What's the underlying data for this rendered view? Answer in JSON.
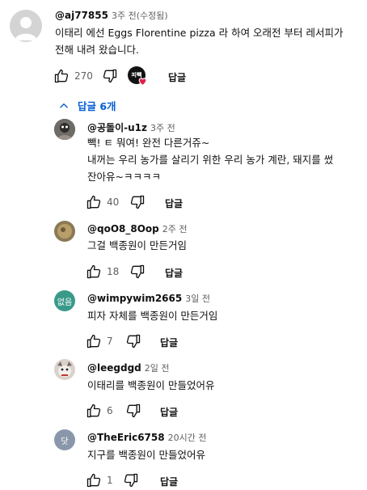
{
  "main_comment": {
    "handle": "@aj77855",
    "time": "3주 전(수정됨)",
    "text_line1": "이태리 에선 Eggs Florentine pizza 라 하여 오래전 부터 레서피가",
    "text_line2": "전해 내려 왔습니다.",
    "likes": "270",
    "reply_label": "답글",
    "creator_badge_text": "피빽"
  },
  "replies_toggle": {
    "label": "답글 6개"
  },
  "replies": [
    {
      "handle": "@공돌이-u1z",
      "time": "3주 전",
      "lines": [
        "빽! ㅌ 뭐여! 완전 다른거쥬~",
        "내꺼는 우리 농가를 살리기 위한 우리 농가 계란, 돼지를 썼",
        "잔아유~ㅋㅋㅋㅋ"
      ],
      "likes": "40",
      "reply_label": "답글"
    },
    {
      "handle": "@qoO8_8Oop",
      "time": "2주 전",
      "lines": [
        "그걸 백종원이 만든거임"
      ],
      "likes": "18",
      "reply_label": "답글"
    },
    {
      "handle": "@wimpywim2665",
      "time": "3일 전",
      "avatar_text": "없음",
      "lines": [
        "피자 자체를 백종원이 만든거임"
      ],
      "likes": "7",
      "reply_label": "답글"
    },
    {
      "handle": "@leegdgd",
      "time": "2일 전",
      "lines": [
        "이태리를 백종원이 만들었어유"
      ],
      "likes": "6",
      "reply_label": "답글"
    },
    {
      "handle": "@TheEric6758",
      "time": "20시간 전",
      "avatar_text": "닷",
      "lines": [
        "지구를 백종원이 만들었어유"
      ],
      "likes": "1",
      "reply_label": "답글"
    }
  ],
  "colors": {
    "link_blue": "#065fd4",
    "wimpy_avatar": "#3a9a8a",
    "eric_avatar": "#8a97ab",
    "creator_heart": "#e0214b"
  }
}
